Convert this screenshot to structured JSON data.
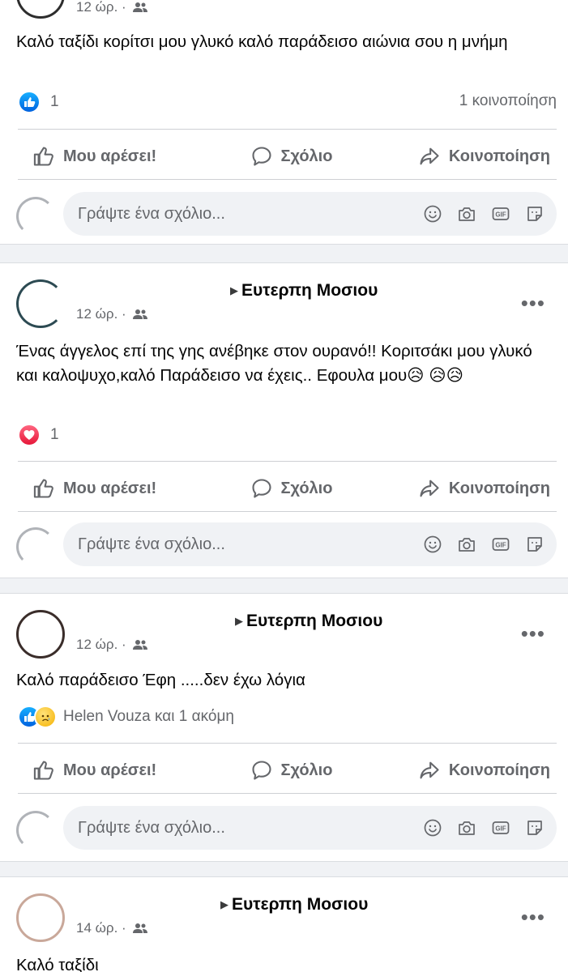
{
  "posts": [
    {
      "author_prefix": "",
      "target": "",
      "time": "12 ώρ. ·",
      "text": "Καλό ταξίδι κορίτσι μου γλυκό καλό παράδεισο αιώνια σου η μνήμη",
      "reaction_type": "like",
      "reaction_count": "1",
      "shares": "1 κοινοποίηση"
    },
    {
      "author_prefix": "",
      "target": "Ευτερπη Μοσιου",
      "time": "12 ώρ. ·",
      "text": "Ένας άγγελος επί της γης ανέβηκε στον ουρανό!! Κοριτσάκι μου γλυκό και καλοψυχο,καλό Παράδεισο να έχεις.. Εφουλα μου😥 😥😥",
      "reaction_type": "love",
      "reaction_count": "1",
      "shares": ""
    },
    {
      "author_prefix": "",
      "target": "Ευτερπη Μοσιου",
      "time": "12 ώρ. ·",
      "text": "Καλό παράδεισο Έφη .....δεν έχω λόγια",
      "reaction_type": "like-sad",
      "reaction_count": "Helen Vouza και 1 ακόμη",
      "shares": ""
    },
    {
      "author_prefix": "",
      "target": "Ευτερπη Μοσιου",
      "time": "14 ώρ. ·",
      "text": "Καλό ταξίδι"
    }
  ],
  "actions": {
    "like": "Μου αρέσει!",
    "comment": "Σχόλιο",
    "share": "Κοινοποίηση"
  },
  "comment_placeholder": "Γράψτε ένα σχόλιο...",
  "more_label": "•••",
  "colors": {
    "link_blue": "#1877f2",
    "secondary_text": "#65676b",
    "divider": "#ced0d4",
    "input_bg": "#f0f2f5",
    "love_red": "#e61739"
  },
  "icons": [
    "like-icon",
    "comment-icon",
    "share-icon",
    "emoji-icon",
    "camera-icon",
    "gif-icon",
    "sticker-icon",
    "people-icon",
    "more-icon"
  ]
}
